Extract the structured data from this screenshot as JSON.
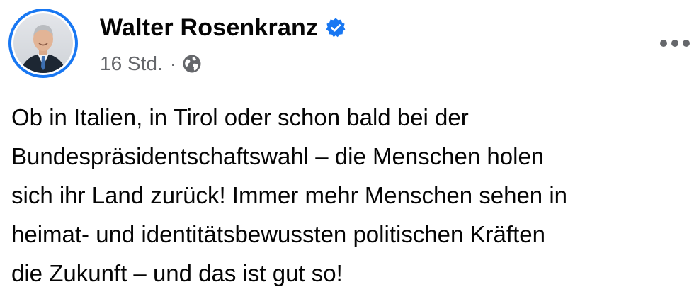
{
  "author": {
    "name": "Walter Rosenkranz",
    "verified": true,
    "avatar_icon": "profile-photo"
  },
  "meta": {
    "timestamp": "16 Std.",
    "separator": "·",
    "audience_icon": "globe-icon"
  },
  "menu_icon": "more-options-icon",
  "post": {
    "lines": [
      "Ob in Italien, in Tirol oder schon bald bei der",
      "Bundespräsidentschaftswahl – die Menschen holen",
      "sich ihr Land zurück! Immer mehr Menschen sehen in",
      "heimat- und identitätsbewussten politischen Kräften",
      "die Zukunft – und das ist gut so!"
    ]
  },
  "colors": {
    "accent": "#1877f2",
    "text": "#050505",
    "secondary_text": "#65676b"
  }
}
